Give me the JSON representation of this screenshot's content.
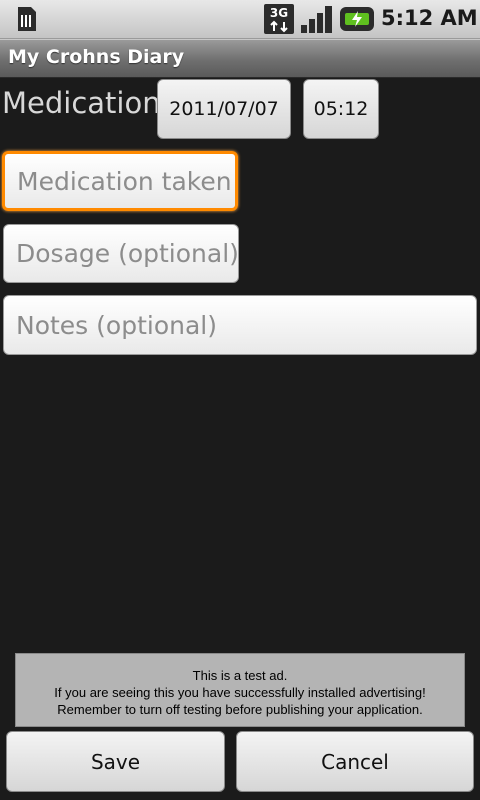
{
  "status_bar": {
    "time": "5:12 AM",
    "network_label": "3G",
    "icons": [
      "sim-icon",
      "3g-data-icon",
      "signal-icon",
      "battery-icon"
    ]
  },
  "app": {
    "title": "My Crohns Diary"
  },
  "form": {
    "heading": "Medication",
    "date_button": "2011/07/07",
    "time_button": "05:12",
    "medication_placeholder": "Medication taken",
    "dosage_placeholder": "Dosage (optional)",
    "notes_placeholder": "Notes (optional)"
  },
  "ad": {
    "lines": [
      "This is a test ad.",
      "If you are seeing this you have successfully installed advertising!",
      "Remember to turn off testing before publishing your application."
    ]
  },
  "actions": {
    "save_label": "Save",
    "cancel_label": "Cancel"
  },
  "colors": {
    "focus_accent": "#ff8a00",
    "background": "#1b1b1b"
  }
}
